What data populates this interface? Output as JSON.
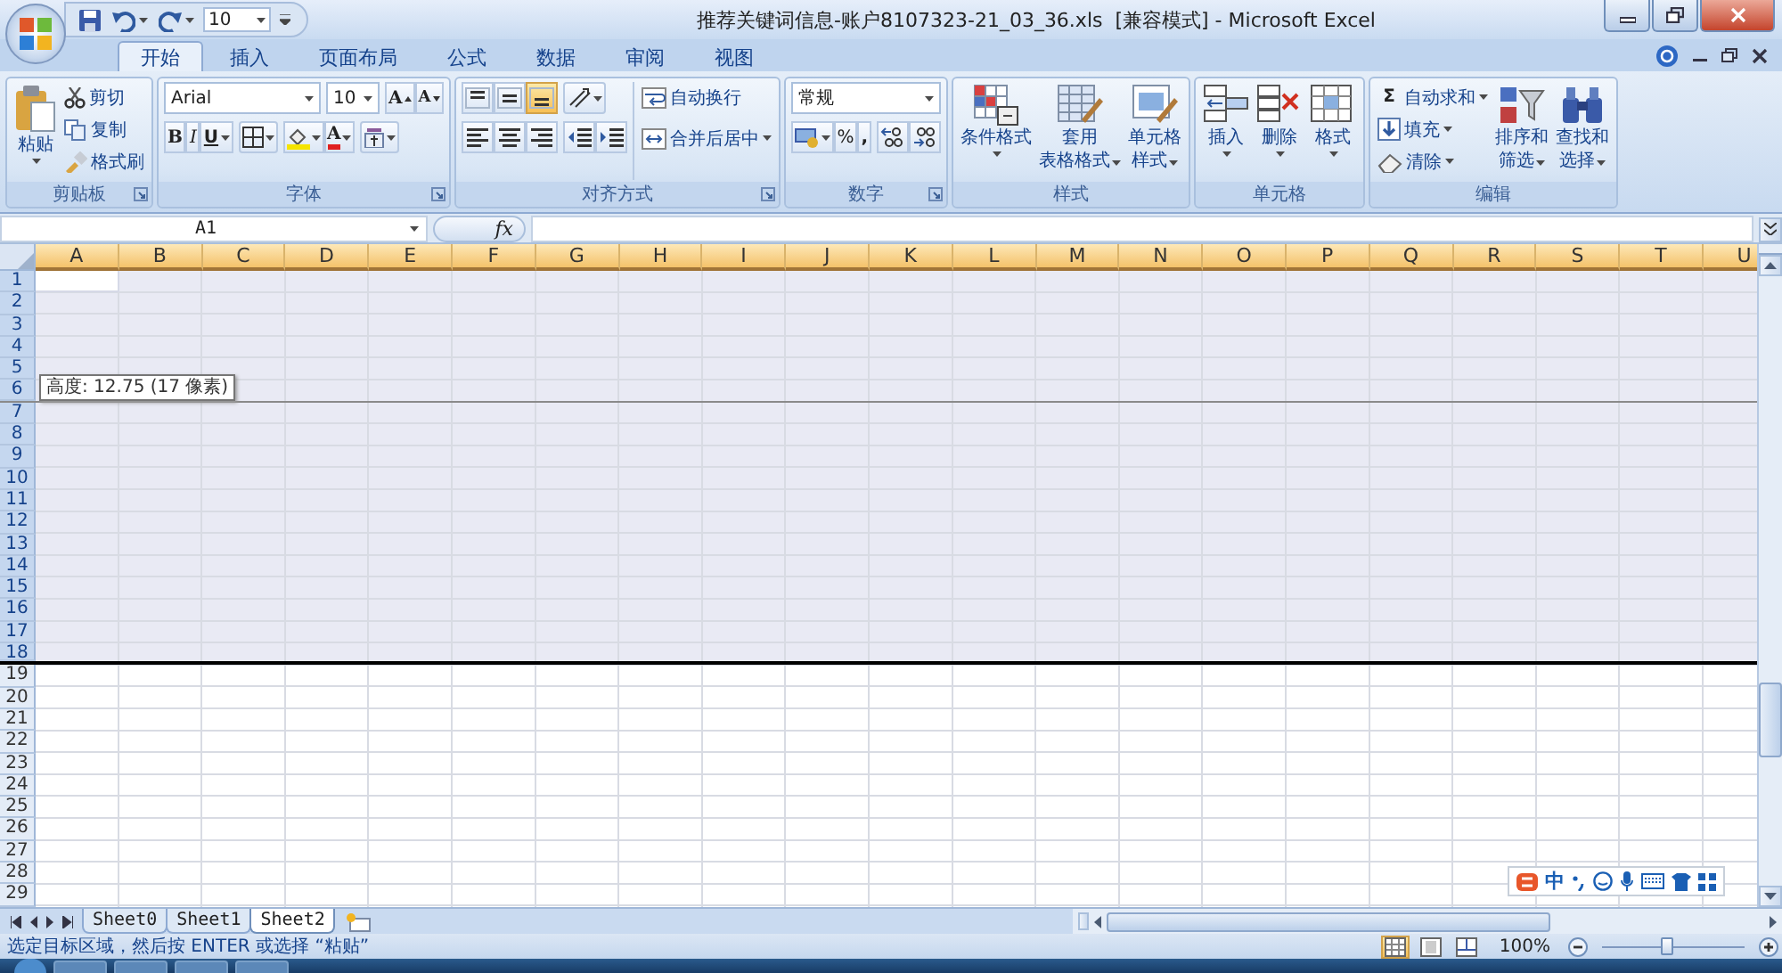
{
  "quick_access": {
    "font_size": "10"
  },
  "window": {
    "title": "推荐关键词信息-账户8107323-21_03_36.xls  [兼容模式] - Microsoft Excel"
  },
  "tabs": [
    {
      "label": "开始",
      "selected": true
    },
    {
      "label": "插入",
      "selected": false
    },
    {
      "label": "页面布局",
      "selected": false
    },
    {
      "label": "公式",
      "selected": false
    },
    {
      "label": "数据",
      "selected": false
    },
    {
      "label": "审阅",
      "selected": false
    },
    {
      "label": "视图",
      "selected": false
    }
  ],
  "ribbon": [
    {
      "kind": "clipboard",
      "name": "剪贴板",
      "paste": "粘贴",
      "items": [
        {
          "kind": "cut",
          "label": "剪切"
        },
        {
          "kind": "copy",
          "label": "复制"
        },
        {
          "kind": "painter",
          "label": "格式刷"
        }
      ]
    },
    {
      "kind": "font",
      "name": "字体",
      "font": "Arial",
      "size": "10",
      "grow": "A",
      "shrink": "A",
      "bold": "B",
      "italic": "I",
      "underline": "U",
      "font_color_letter": "A"
    },
    {
      "kind": "alignment",
      "name": "对齐方式",
      "valign": [
        {
          "kind": "top",
          "selected": false
        },
        {
          "kind": "middle",
          "selected": false
        },
        {
          "kind": "bottom",
          "selected": true
        }
      ],
      "wrap": "自动换行",
      "merge": "合并后居中"
    },
    {
      "kind": "number",
      "name": "数字",
      "format": "常规",
      "percent": "%",
      "comma": ","
    },
    {
      "kind": "buttons",
      "name": "样式",
      "buttons": [
        {
          "kind": "conditional",
          "lines": [
            "条件格式"
          ]
        },
        {
          "kind": "table",
          "lines": [
            "套用",
            "表格格式"
          ]
        },
        {
          "kind": "cellstyle",
          "lines": [
            "单元格",
            "样式"
          ]
        }
      ]
    },
    {
      "kind": "buttons",
      "name": "单元格",
      "buttons": [
        {
          "kind": "insert",
          "lines": [
            "插入"
          ]
        },
        {
          "kind": "delete",
          "lines": [
            "删除"
          ]
        },
        {
          "kind": "format",
          "lines": [
            "格式"
          ]
        }
      ]
    },
    {
      "kind": "editing",
      "name": "编辑",
      "items": [
        {
          "kind": "sum",
          "symbol": "Σ",
          "label": "自动求和"
        },
        {
          "kind": "fill",
          "label": "填充"
        },
        {
          "kind": "clear",
          "label": "清除"
        }
      ],
      "buttons": [
        {
          "kind": "sort",
          "lines": [
            "排序和",
            "筛选"
          ]
        },
        {
          "kind": "find",
          "lines": [
            "查找和",
            "选择"
          ]
        }
      ]
    }
  ],
  "formula_bar": {
    "name_box": "A1",
    "fx": "fx"
  },
  "sheet": {
    "columns": [
      {
        "label": "A",
        "selected": true
      },
      {
        "label": "B",
        "selected": true
      },
      {
        "label": "C",
        "selected": true
      },
      {
        "label": "D",
        "selected": true
      },
      {
        "label": "E",
        "selected": true
      },
      {
        "label": "F",
        "selected": true
      },
      {
        "label": "G",
        "selected": true
      },
      {
        "label": "H",
        "selected": true
      },
      {
        "label": "I",
        "selected": true
      },
      {
        "label": "J",
        "selected": true
      },
      {
        "label": "K",
        "selected": true
      },
      {
        "label": "L",
        "selected": true
      },
      {
        "label": "M",
        "selected": true
      },
      {
        "label": "N",
        "selected": true
      },
      {
        "label": "O",
        "selected": true
      },
      {
        "label": "P",
        "selected": true
      },
      {
        "label": "Q",
        "selected": true
      },
      {
        "label": "R",
        "selected": true
      },
      {
        "label": "S",
        "selected": true
      },
      {
        "label": "T",
        "selected": true
      },
      {
        "label": "U",
        "selected": true
      }
    ],
    "rows": [
      {
        "label": "1",
        "selected": true
      },
      {
        "label": "2",
        "selected": true
      },
      {
        "label": "3",
        "selected": true
      },
      {
        "label": "4",
        "selected": true
      },
      {
        "label": "5",
        "selected": true
      },
      {
        "label": "6",
        "selected": true,
        "tooltip": "高度: 12.75 (17 像素)"
      },
      {
        "label": "7",
        "selected": true
      },
      {
        "label": "8",
        "selected": true
      },
      {
        "label": "9",
        "selected": true
      },
      {
        "label": "10",
        "selected": true
      },
      {
        "label": "11",
        "selected": true
      },
      {
        "label": "12",
        "selected": true
      },
      {
        "label": "13",
        "selected": true
      },
      {
        "label": "14",
        "selected": true
      },
      {
        "label": "15",
        "selected": true
      },
      {
        "label": "16",
        "selected": true
      },
      {
        "label": "17",
        "selected": true
      },
      {
        "label": "18",
        "selected": true
      },
      {
        "label": "19",
        "selected": false
      },
      {
        "label": "20",
        "selected": false
      },
      {
        "label": "21",
        "selected": false
      },
      {
        "label": "22",
        "selected": false
      },
      {
        "label": "23",
        "selected": false
      },
      {
        "label": "24",
        "selected": false
      },
      {
        "label": "25",
        "selected": false
      },
      {
        "label": "26",
        "selected": false
      },
      {
        "label": "27",
        "selected": false
      },
      {
        "label": "28",
        "selected": false
      },
      {
        "label": "29",
        "selected": false
      }
    ]
  },
  "sheet_tabs": [
    {
      "label": "Sheet0",
      "selected": false
    },
    {
      "label": "Sheet1",
      "selected": false
    },
    {
      "label": "Sheet2",
      "selected": true
    }
  ],
  "status_bar": {
    "text": "选定目标区域，然后按 ENTER 或选择 “粘贴”",
    "views": [
      {
        "kind": "normal",
        "selected": true
      },
      {
        "kind": "layout",
        "selected": false
      },
      {
        "kind": "break",
        "selected": false
      }
    ],
    "zoom": {
      "label": "100%",
      "level": 0.45
    }
  },
  "ime_bar": {
    "label": "中"
  }
}
